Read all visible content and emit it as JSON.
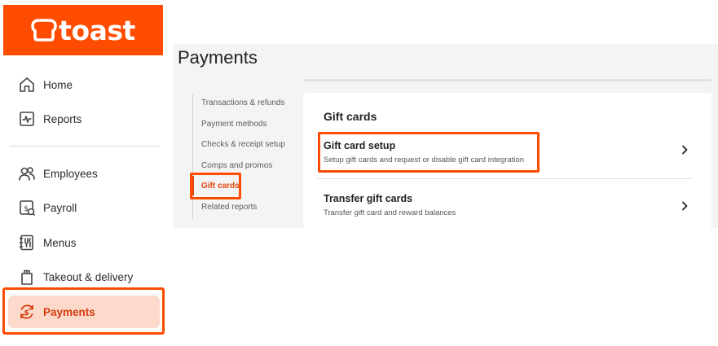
{
  "brand": {
    "logo_text": "toast",
    "accent_color": "#ff4c00",
    "active_bg": "#fdd9cc",
    "highlight_color": "#ff4c00"
  },
  "sidebar": {
    "items": [
      {
        "label": "Home",
        "icon": "home-icon",
        "active": false
      },
      {
        "label": "Reports",
        "icon": "reports-icon",
        "active": false
      },
      {
        "label": "Employees",
        "icon": "employees-icon",
        "active": false
      },
      {
        "label": "Payroll",
        "icon": "payroll-icon",
        "active": false
      },
      {
        "label": "Menus",
        "icon": "menus-icon",
        "active": false
      },
      {
        "label": "Takeout & delivery",
        "icon": "takeout-icon",
        "active": false
      },
      {
        "label": "Payments",
        "icon": "payments-icon",
        "active": true
      }
    ]
  },
  "main": {
    "page_title": "Payments",
    "subnav": [
      {
        "label": "Transactions & refunds",
        "active": false
      },
      {
        "label": "Payment methods",
        "active": false
      },
      {
        "label": "Checks & receipt setup",
        "active": false
      },
      {
        "label": "Comps and promos",
        "active": false
      },
      {
        "label": "Gift cards",
        "active": true
      },
      {
        "label": "Related reports",
        "active": false
      }
    ],
    "card": {
      "heading": "Gift cards",
      "rows": [
        {
          "title": "Gift card setup",
          "subtitle": "Setup gift cards and request or disable gift card integration",
          "icon": "chevron-right-icon"
        },
        {
          "title": "Transfer gift cards",
          "subtitle": "Transfer gift card and reward balances",
          "icon": "chevron-right-icon"
        }
      ]
    }
  }
}
